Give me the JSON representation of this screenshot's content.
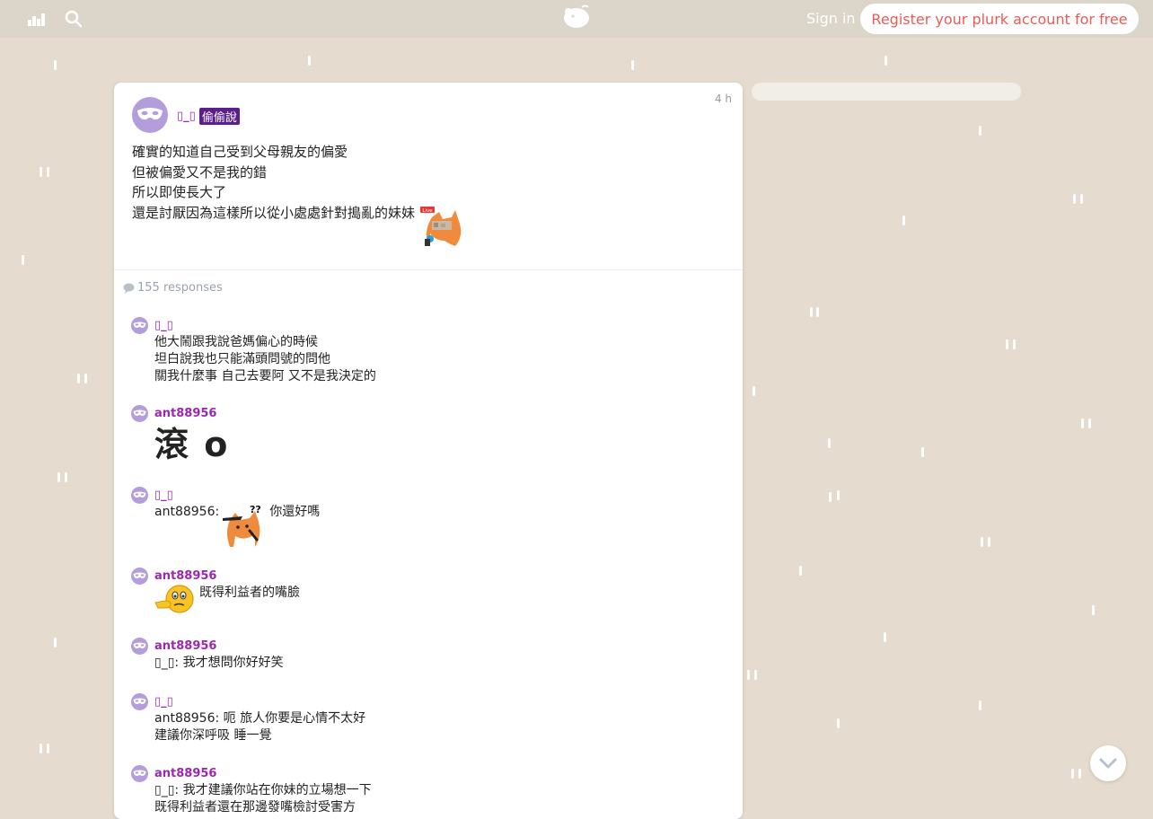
{
  "topbar": {
    "stats_icon": "stats-icon",
    "search_icon": "search-icon",
    "logo_icon": "plurk-logo",
    "signin_label": "Sign in",
    "register_label": "Register your plurk account for free"
  },
  "post": {
    "author": "▯_▯",
    "qualifier": "偷偷說",
    "time": "4 h",
    "lines": [
      "確實的知道自己受到父母親友的偏愛",
      "但被偏愛又不是我的錯",
      "所以即使長大了",
      "還是討厭因為這樣所以從小處處針對搗亂的妹妹"
    ],
    "sticker_label": "Live"
  },
  "responses_count": "155 responses",
  "responses": [
    {
      "name": "▯_▯",
      "lines": [
        "他大鬧跟我說爸媽偏心的時候",
        "坦白說我也只能滿頭問號的問他",
        "關我什麼事 自己去要阿 又不是我決定的"
      ]
    },
    {
      "name": "ant88956",
      "big": "滾 o"
    },
    {
      "name": "▯_▯",
      "prefix": "ant88956:",
      "suffix": "你還好嗎"
    },
    {
      "name": "ant88956",
      "text": "既得利益者的嘴臉"
    },
    {
      "name": "ant88956",
      "lines": [
        "▯_▯: 我才想問你好好笑"
      ]
    },
    {
      "name": "▯_▯",
      "lines": [
        "ant88956: 呃 旅人你要是心情不太好",
        "建議你深呼吸 睡一覺"
      ]
    },
    {
      "name": "ant88956",
      "lines": [
        "▯_▯: 我才建議你站在你妹的立場想一下",
        "既得利益者還在那邊發嘴檢討受害方"
      ]
    }
  ],
  "colors": {
    "accent": "#9c27b0",
    "qualifier_bg": "#5a1f8c",
    "register_text": "#ec5a55",
    "background": "#e5dccf"
  }
}
